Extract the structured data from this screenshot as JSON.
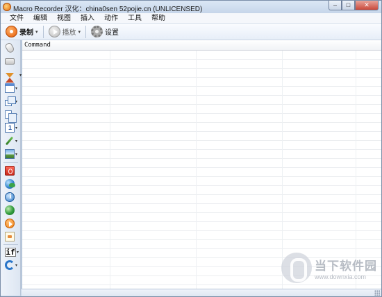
{
  "window": {
    "title": "Macro Recorder 汉化：china0sen 52pojie.cn (UNLICENSED)",
    "controls": {
      "minimize": "–",
      "maximize": "□",
      "close": "✕"
    }
  },
  "menu": {
    "items": [
      {
        "label": "文件"
      },
      {
        "label": "编辑"
      },
      {
        "label": "视图"
      },
      {
        "label": "插入"
      },
      {
        "label": "动作"
      },
      {
        "label": "工具"
      },
      {
        "label": "帮助"
      }
    ]
  },
  "toolbar": {
    "record_label": "录制",
    "play_label": "播放",
    "settings_label": "设置",
    "dropdown_glyph": "▾"
  },
  "palette": {
    "dropdown_glyph": "▾",
    "tools": [
      {
        "icon": "mouse-icon"
      },
      {
        "icon": "keyboard-icon"
      },
      {
        "icon": "hourglass-icon"
      },
      {
        "icon": "window-icon"
      },
      {
        "icon": "windows-icon"
      },
      {
        "icon": "copy-icon"
      },
      {
        "icon": "textbox-icon"
      },
      {
        "icon": "brush-icon"
      },
      {
        "icon": "image-icon"
      },
      {
        "icon": "stop-icon"
      },
      {
        "icon": "globe-icon"
      },
      {
        "icon": "info-icon"
      },
      {
        "icon": "globe-green-icon"
      },
      {
        "icon": "play-orange-icon"
      },
      {
        "icon": "note-icon"
      },
      {
        "icon": "if-icon",
        "text": "if"
      },
      {
        "icon": "loop-icon"
      }
    ]
  },
  "grid": {
    "column_header": "Command",
    "rows": []
  },
  "watermark": {
    "brand": "当下软件园",
    "url": "www.downxia.com"
  }
}
